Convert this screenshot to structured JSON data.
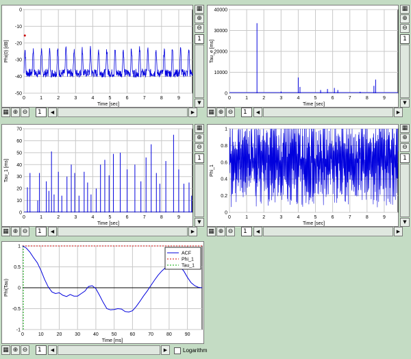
{
  "colors": {
    "trace": "#0000dd",
    "grid": "#c8c8c8",
    "axis": "#000000",
    "background": "#c4dcc4",
    "phi_line": "#cc0000",
    "tau_line": "#00aa00"
  },
  "zoom_values": {
    "p1": "1",
    "p2": "1",
    "p3": "1",
    "p4": "1",
    "p5": "1"
  },
  "h_zoom": {
    "p1": "1",
    "p2": "1",
    "p3": "1",
    "p4": "1",
    "p5": "1"
  },
  "icons": [
    "zoom-in-icon",
    "zoom-out-icon",
    "grid-icon"
  ],
  "logarithm_label": "Logarithm",
  "chart_data": [
    {
      "type": "line",
      "ylabel": "Phi(0) [dB]",
      "xlabel": "Time [sec]",
      "xlim": [
        0,
        9.8
      ],
      "ylim": [
        -50,
        0
      ],
      "xticks": [
        0,
        1,
        2,
        3,
        4,
        5,
        6,
        7,
        8,
        9
      ],
      "yticks": [
        0,
        -10,
        -20,
        -30,
        -40,
        -50
      ],
      "series": [
        {
          "values": []
        }
      ]
    },
    {
      "type": "line",
      "ylabel": "Tau_e [ms]",
      "xlabel": "Time [sec]",
      "xlim": [
        0,
        9.8
      ],
      "ylim": [
        0,
        40000
      ],
      "xticks": [
        0,
        1,
        2,
        3,
        4,
        5,
        6,
        7,
        8,
        9
      ],
      "yticks": [
        0,
        10000,
        20000,
        30000,
        40000
      ],
      "spikes": [
        [
          1.6,
          33500
        ],
        [
          4.0,
          7500
        ],
        [
          4.1,
          3000
        ],
        [
          5.3,
          1500
        ],
        [
          5.7,
          2000
        ],
        [
          6.1,
          2500
        ],
        [
          6.3,
          1500
        ],
        [
          8.4,
          3500
        ],
        [
          8.5,
          6500
        ],
        [
          3.0,
          800
        ],
        [
          7.6,
          700
        ]
      ]
    },
    {
      "type": "line",
      "ylabel": "Tau_1 [ms]",
      "xlabel": "Time [sec]",
      "xlim": [
        0,
        9.8
      ],
      "ylim": [
        0,
        70
      ],
      "xticks": [
        0,
        1,
        2,
        3,
        4,
        5,
        6,
        7,
        8,
        9
      ],
      "yticks": [
        0,
        10,
        20,
        30,
        40,
        50,
        60,
        70
      ],
      "spikes": [
        [
          0.2,
          21
        ],
        [
          0.35,
          33
        ],
        [
          0.8,
          10
        ],
        [
          0.9,
          33
        ],
        [
          1.3,
          26
        ],
        [
          1.45,
          18
        ],
        [
          1.6,
          51
        ],
        [
          1.75,
          15
        ],
        [
          2.0,
          34
        ],
        [
          2.2,
          14
        ],
        [
          2.5,
          30
        ],
        [
          2.75,
          40
        ],
        [
          2.95,
          33
        ],
        [
          3.2,
          14
        ],
        [
          3.5,
          34
        ],
        [
          3.7,
          25
        ],
        [
          3.9,
          15
        ],
        [
          4.2,
          20
        ],
        [
          4.45,
          40
        ],
        [
          4.7,
          44
        ],
        [
          4.95,
          31
        ],
        [
          5.2,
          49
        ],
        [
          5.6,
          50
        ],
        [
          6.0,
          36
        ],
        [
          6.45,
          40
        ],
        [
          6.8,
          26
        ],
        [
          7.1,
          46
        ],
        [
          7.4,
          57
        ],
        [
          7.7,
          33
        ],
        [
          7.9,
          24
        ],
        [
          8.25,
          43
        ],
        [
          8.7,
          65
        ],
        [
          9.0,
          36
        ],
        [
          9.3,
          24
        ],
        [
          9.6,
          25
        ],
        [
          9.75,
          14
        ]
      ]
    },
    {
      "type": "line",
      "ylabel": "Phi_1",
      "xlabel": "Time [sec]",
      "xlim": [
        0,
        9.8
      ],
      "ylim": [
        0,
        1
      ],
      "xticks": [
        0,
        1,
        2,
        3,
        4,
        5,
        6,
        7,
        8,
        9
      ],
      "yticks": [
        0,
        0.2,
        0.4,
        0.6,
        0.8,
        1
      ]
    },
    {
      "type": "line",
      "ylabel": "Phi(Tau)",
      "xlabel": "Time [ms]",
      "xlim": [
        0,
        98
      ],
      "ylim": [
        -1,
        1
      ],
      "xticks": [
        0,
        10,
        20,
        30,
        40,
        50,
        60,
        70,
        80,
        90
      ],
      "yticks": [
        -1,
        -0.5,
        0,
        0.5,
        1
      ],
      "series": [
        {
          "name": "ACF",
          "x": [
            0,
            2,
            4,
            6,
            8,
            10,
            12,
            14,
            16,
            18,
            20,
            22,
            24,
            26,
            28,
            30,
            32,
            34,
            36,
            38,
            40,
            42,
            44,
            46,
            48,
            50,
            52,
            54,
            56,
            58,
            60,
            62,
            64,
            66,
            68,
            70,
            72,
            74,
            76,
            78,
            80,
            82,
            84,
            86,
            88,
            90,
            92,
            94,
            96,
            98
          ],
          "values": [
            1,
            0.95,
            0.85,
            0.72,
            0.6,
            0.42,
            0.2,
            0.02,
            -0.1,
            -0.14,
            -0.12,
            -0.18,
            -0.21,
            -0.16,
            -0.2,
            -0.2,
            -0.14,
            -0.08,
            0.03,
            0.05,
            -0.02,
            -0.18,
            -0.35,
            -0.5,
            -0.53,
            -0.52,
            -0.5,
            -0.51,
            -0.57,
            -0.58,
            -0.55,
            -0.45,
            -0.33,
            -0.2,
            -0.08,
            0.05,
            0.18,
            0.3,
            0.4,
            0.48,
            0.55,
            0.58,
            0.55,
            0.5,
            0.4,
            0.25,
            0.12,
            0.05,
            0.01,
            0.0
          ]
        },
        {
          "name": "Phi_1",
          "x": [
            0,
            98
          ],
          "values": [
            1,
            1
          ]
        },
        {
          "name": "Tau_1",
          "x": [
            0,
            0
          ],
          "values": [
            -1,
            1
          ]
        }
      ],
      "legend": "top-right"
    }
  ]
}
